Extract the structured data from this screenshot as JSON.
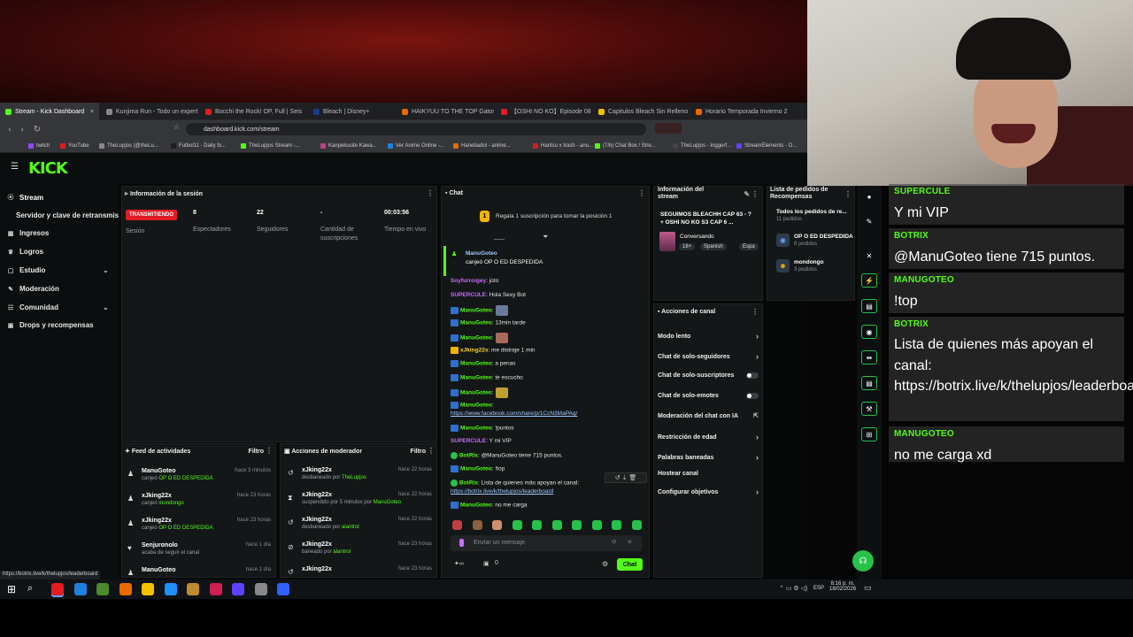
{
  "browser": {
    "tabs": [
      {
        "label": "Stream - Kick Dashboard",
        "active": true,
        "color": "#53fc18"
      },
      {
        "label": "Kunjima Run - Todo un expert",
        "color": "#888888"
      },
      {
        "label": "Bocchi the Rock! OP, Full | Seis",
        "color": "#e31b23"
      },
      {
        "label": "Bleach | Disney+",
        "color": "#1a3a8a"
      },
      {
        "label": "HAIKYUU TO THE TOP Gatos co",
        "color": "#e86a00"
      },
      {
        "label": "【OSHI NO KO】Episode 08 - Vi",
        "color": "#e31b23"
      },
      {
        "label": "Capitulos Bleach Sin Relleno y",
        "color": "#f2c200"
      },
      {
        "label": "Horario Temporada Invierno 2",
        "color": "#e86a00"
      }
    ],
    "url": "dashboard.kick.com/stream",
    "bookmarks": [
      "twitch",
      "YouTube",
      "TheLupjos (@theLu...",
      "Futbol11 - Daily fo...",
      "TheLupjos Stream -...",
      "Kanpekusite Kawa...",
      "Ver Anime Online -...",
      "Hanebadol - anime...",
      "Hantsu x trash - anu...",
      "(7/b) Chat Box / Stre...",
      "TheLupjos - Inggerf...",
      "StreamElements - O..."
    ],
    "status_url": "https://botrix.live/k/thelupjos/leaderboard"
  },
  "sidebar": {
    "items": [
      {
        "label": "Stream",
        "icon": "broadcast-icon"
      },
      {
        "label": "Servidor y clave de retransmisión",
        "icon": ""
      },
      {
        "label": "Ingresos",
        "icon": "money-icon"
      },
      {
        "label": "Logros",
        "icon": "trophy-icon"
      },
      {
        "label": "Estudio",
        "icon": "studio-icon"
      },
      {
        "label": "Moderación",
        "icon": "wrench-icon"
      },
      {
        "label": "Comunidad",
        "icon": "users-icon"
      },
      {
        "label": "Drops y recompensas",
        "icon": "gift-icon"
      }
    ]
  },
  "session": {
    "title": "Información de la sesión",
    "status": "TRANSMITIENDO",
    "session_label": "Sesión",
    "stats": [
      {
        "value": "8",
        "label": "Espectadores"
      },
      {
        "value": "22",
        "label": "Seguidores"
      },
      {
        "value": "-",
        "label": "Cantidad de suscripciones"
      },
      {
        "value": "00:03:56",
        "label": "Tiempo en vivo"
      }
    ]
  },
  "feed": {
    "title": "Feed de actividades",
    "filter": "Filtro",
    "rows": [
      {
        "name": "ManuGoteo",
        "sub": "canjeó",
        "hl": "OP O ED DESPEDIDA",
        "time": "hace 3 minutos"
      },
      {
        "name": "xJking22x",
        "sub": "canjeó",
        "hl": "mondongo",
        "time": "hace 23 horas"
      },
      {
        "name": "xJking22x",
        "sub": "canjeó",
        "hl": "OP O ED DESPEDIDA",
        "time": "hace 23 horas"
      },
      {
        "name": "Senjuronolo",
        "sub": "acaba de seguir el canal",
        "hl": "",
        "time": "hace 1 día"
      },
      {
        "name": "ManuGoteo",
        "sub": "",
        "hl": "",
        "time": "hace 1 día"
      }
    ]
  },
  "modactions": {
    "title": "Acciones de moderador",
    "filter": "Filtro",
    "rows": [
      {
        "name": "xJking22x",
        "sub": "desbaneado por",
        "hl": "TheLupjos",
        "time": "hace 22 horas"
      },
      {
        "name": "xJking22x",
        "sub": "suspendido por 5 minutos por",
        "hl": "ManuGoteo",
        "time": "hace 22 horas"
      },
      {
        "name": "xJking22x",
        "sub": "desbaneado por",
        "hl": "alantrol",
        "time": "hace 22 horas"
      },
      {
        "name": "xJking22x",
        "sub": "baneado por",
        "hl": "alantrol",
        "time": "hace 23 horas"
      },
      {
        "name": "xJking22x",
        "sub": "",
        "hl": "",
        "time": "hace 23 horas"
      }
    ]
  },
  "chat": {
    "title": "Chat",
    "pinned": "Regala 1 suscripción para tomar la posición 1",
    "redeem_user": "ManuGoteo",
    "redeem_text": "canjeó OP O ED DESPEDIDA",
    "messages": [
      {
        "user": "Soyfurroigey",
        "color": "cp",
        "text": ": joto"
      },
      {
        "user": "SUPERCULE",
        "color": "cp",
        "text": ": Hola Sexy Bot"
      },
      {
        "user": "ManuGoteo",
        "color": "cu",
        "text": ":"
      },
      {
        "user": "ManuGoteo",
        "color": "cu",
        "text": ": 13min tarde"
      },
      {
        "user": "ManuGoteo",
        "color": "cu",
        "text": ":"
      },
      {
        "user": "xJking22x",
        "color": "cy",
        "text": ": me distraje 1 min"
      },
      {
        "user": "ManuGoteo",
        "color": "cu",
        "text": ": a penas"
      },
      {
        "user": "ManuGoteo",
        "color": "cu",
        "text": ": te escucho"
      },
      {
        "user": "ManuGoteo",
        "color": "cu",
        "text": ":"
      },
      {
        "user": "ManuGoteo",
        "color": "cu",
        "text": ":"
      },
      {
        "user": "",
        "color": "link",
        "text": "https://www.facebook.com/share/p/1CcN3MaPAg/"
      },
      {
        "user": "ManuGoteo",
        "color": "cu",
        "text": ": !puntos"
      },
      {
        "user": "SUPERCULE",
        "color": "cp",
        "text": ": Y mi VIP"
      },
      {
        "user": "BotRix",
        "color": "cu",
        "text": ": @ManuGoteo tiene 715 puntos."
      },
      {
        "user": "ManuGoteo",
        "color": "cu",
        "text": ": !top"
      },
      {
        "user": "BotRix",
        "color": "cu",
        "text": ": Lista de quienes más apoyan el canal:"
      },
      {
        "user": "",
        "color": "link",
        "text": "https://botrix.live/k/thelupjos/leaderboard"
      },
      {
        "user": "ManuGoteo",
        "color": "cu",
        "text": ": no me carga"
      }
    ],
    "input_placeholder": "Enviar un mensaje",
    "points": "0",
    "send_label": "Chat"
  },
  "streaminfo": {
    "title": "Información del stream",
    "stream_title": "SEGUIMOS BLEACHH CAP 63 - ? + OSHI NO KO S3 CAP 6 ...",
    "category": "Conversando",
    "tags": [
      "18+",
      "Spanish",
      "Espa"
    ]
  },
  "rewards": {
    "title": "Lista de pedidos de Recompensas",
    "all_label": "Todos los pedidos de re...",
    "all_count": "11 pedidos",
    "items": [
      {
        "name": "OP O ED DESPEDIDA",
        "count": "8 pedidos"
      },
      {
        "name": "mondongo",
        "count": "3 pedidos"
      }
    ]
  },
  "channel_actions": {
    "title": "Acciones de canal",
    "rows": [
      {
        "label": "Modo lento",
        "ctrl": "chev"
      },
      {
        "label": "Chat de solo-seguidores",
        "ctrl": "chev"
      },
      {
        "label": "Chat de solo-suscriptores",
        "ctrl": "toggle"
      },
      {
        "label": "Chat de solo-emotes",
        "ctrl": "toggle"
      },
      {
        "label": "Moderación del chat con IA",
        "ctrl": "ext"
      },
      {
        "label": "Restricción de edad",
        "ctrl": "chev"
      },
      {
        "label": "Palabras baneadas",
        "ctrl": "chev"
      },
      {
        "label": "Hostear canal",
        "ctrl": ""
      },
      {
        "label": "Configurar objetivos",
        "ctrl": "chev"
      }
    ]
  },
  "overlay_chat": [
    {
      "name": "SUPERCULE",
      "msg": "Y mi VIP"
    },
    {
      "name": "BOTRIX",
      "msg": "@ManuGoteo tiene 715 puntos."
    },
    {
      "name": "MANUGOTEO",
      "msg": "!top"
    },
    {
      "name": "BOTRIX",
      "msg": "Lista de quienes más apoyan el canal: https://botrix.live/k/thelupjos/leaderboard"
    },
    {
      "name": "MANUGOTEO",
      "msg": "no me carga xd"
    }
  ],
  "taskbar": {
    "time": "8:16 p. m.",
    "date": "18/02/2026",
    "lang": "ESP"
  }
}
